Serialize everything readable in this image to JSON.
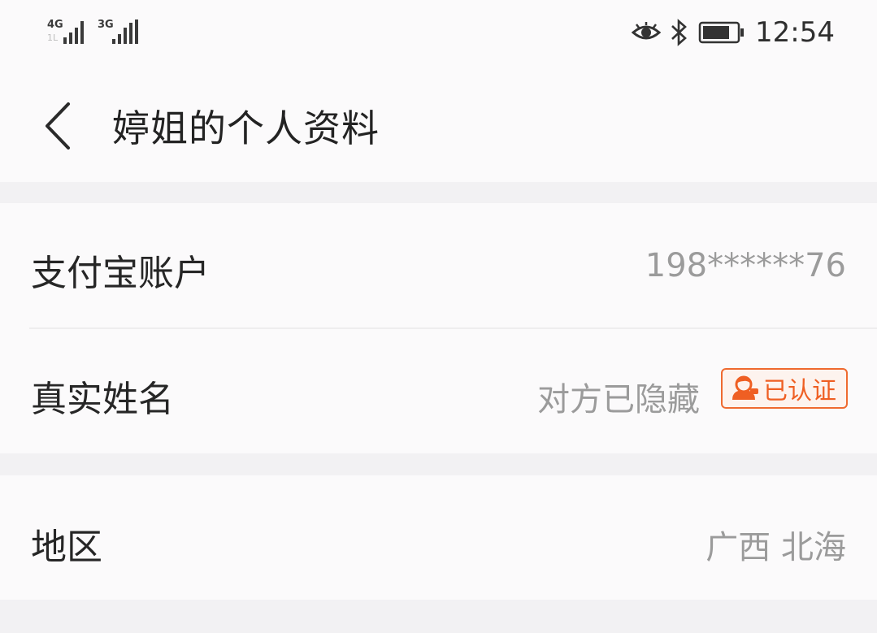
{
  "status_bar": {
    "network_1": "4G",
    "network_1_sub": "1L",
    "network_2": "3G",
    "time": "12:54",
    "icons": [
      "eye-icon",
      "bluetooth-icon",
      "battery-icon"
    ]
  },
  "header": {
    "back_icon": "chevron-left-icon",
    "title": "婷姐的个人资料"
  },
  "profile": {
    "alipay_label": "支付宝账户",
    "alipay_value": "198******76",
    "real_name_label": "真实姓名",
    "real_name_value": "对方已隐藏",
    "verified_badge": "已认证",
    "region_label": "地区",
    "region_value": "广西 北海"
  },
  "colors": {
    "background": "#f2f1f3",
    "card": "#fbfafb",
    "badge_accent": "#ef5f23",
    "secondary_text": "#9b9b9b"
  }
}
